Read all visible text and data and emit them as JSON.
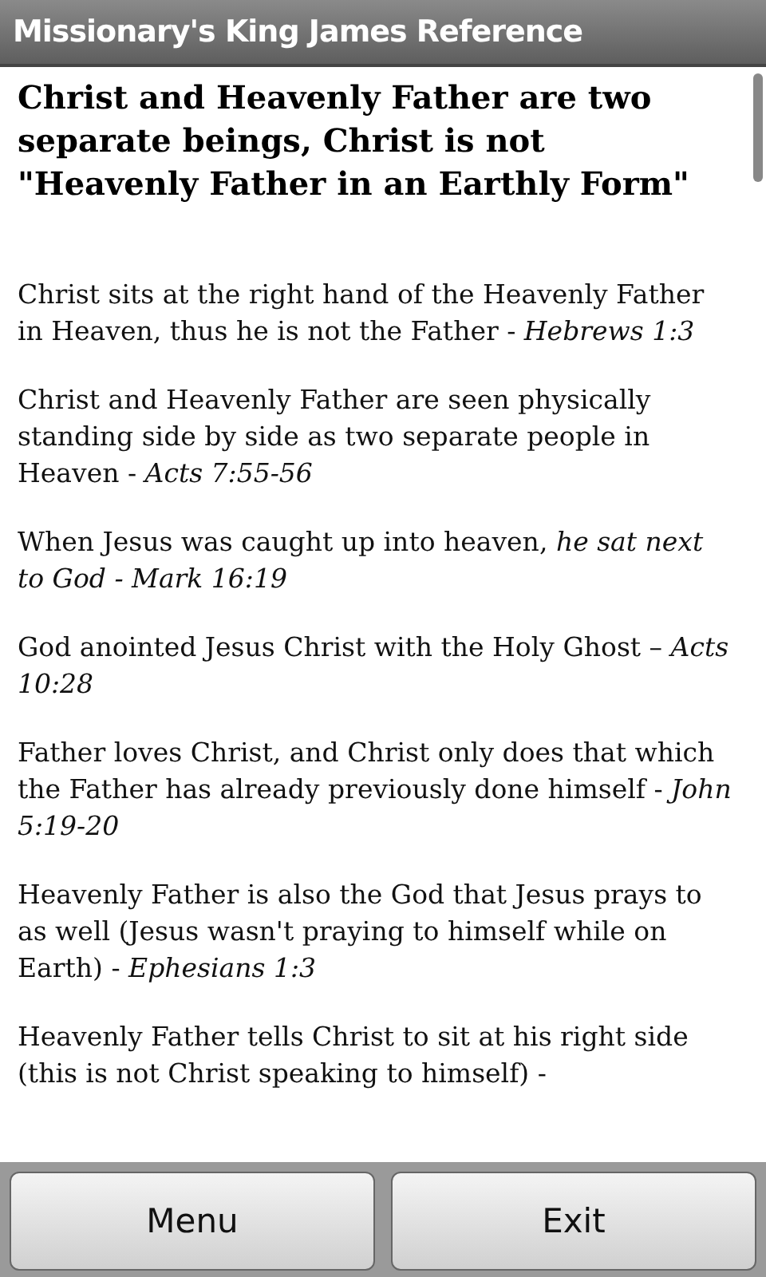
{
  "window": {
    "title": "Missionary's King James Reference"
  },
  "heading": "Christ and Heavenly Father are two separate beings, Christ is not \"Heavenly Father in an Earthly Form\"",
  "entries": [
    "Christ sits at the right hand of the Heavenly Father in Heaven, thus he is not the Father - *Hebrews 1:3*",
    "Christ and Heavenly Father are seen physically standing side by side as two separate people in Heaven - *Acts 7:55-56*",
    "When Jesus was caught up into heaven, *he sat next to God - Mark 16:19*",
    "God anointed Jesus Christ with the Holy Ghost – *Acts 10:28*",
    "Father loves Christ, and Christ only does that which the Father has already previously done himself - *John 5:19-20*",
    "Heavenly Father is also the God that Jesus prays to as well (Jesus wasn't praying to himself while on Earth) - *Ephesians 1:3*",
    "Heavenly Father tells Christ to sit at his right side (this is not Christ speaking to himself) -"
  ],
  "buttons": [
    "Menu",
    "Exit"
  ]
}
